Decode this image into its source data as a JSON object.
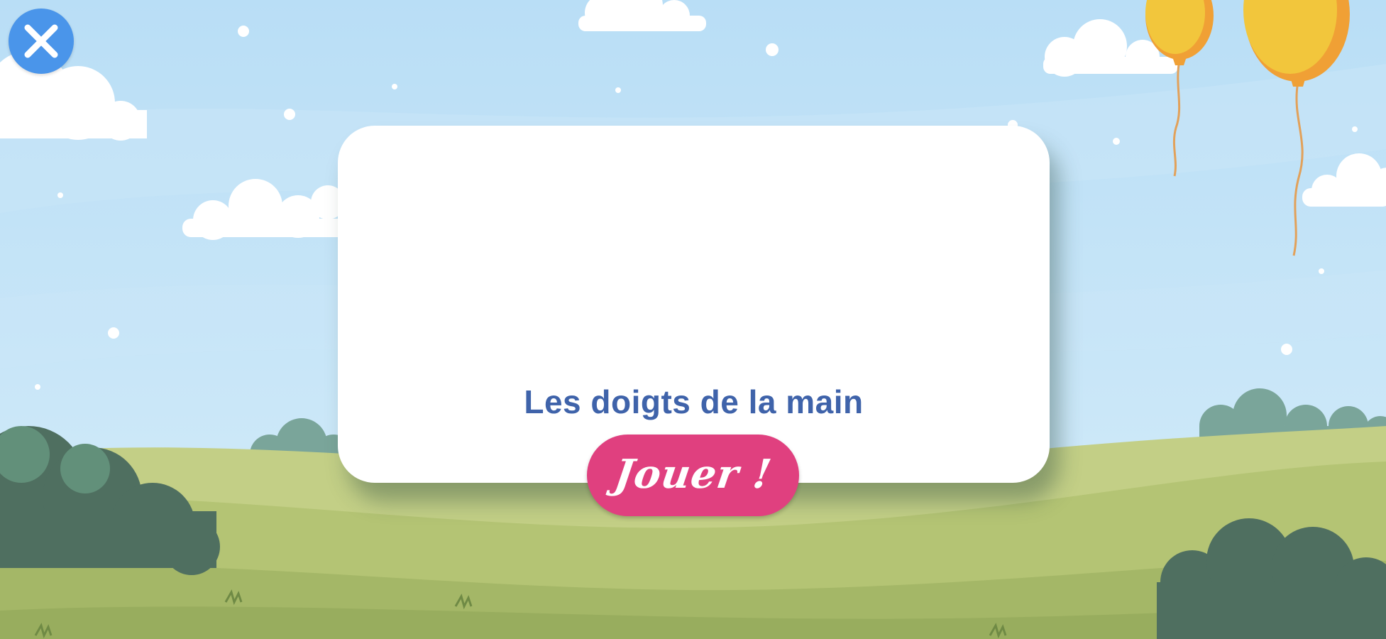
{
  "activity": {
    "title": "Les doigts de la main",
    "play_label": "Jouer !"
  },
  "icons": {
    "close": "close-icon"
  },
  "colors": {
    "sky": "#bfe3f7",
    "card": "#ffffff",
    "title_text": "#3f63aa",
    "play_button": "#e0407f",
    "close_button": "#4a95ea",
    "balloon": "#f2c63c",
    "grass": "#b4c474",
    "bush": "#4f6f60"
  }
}
